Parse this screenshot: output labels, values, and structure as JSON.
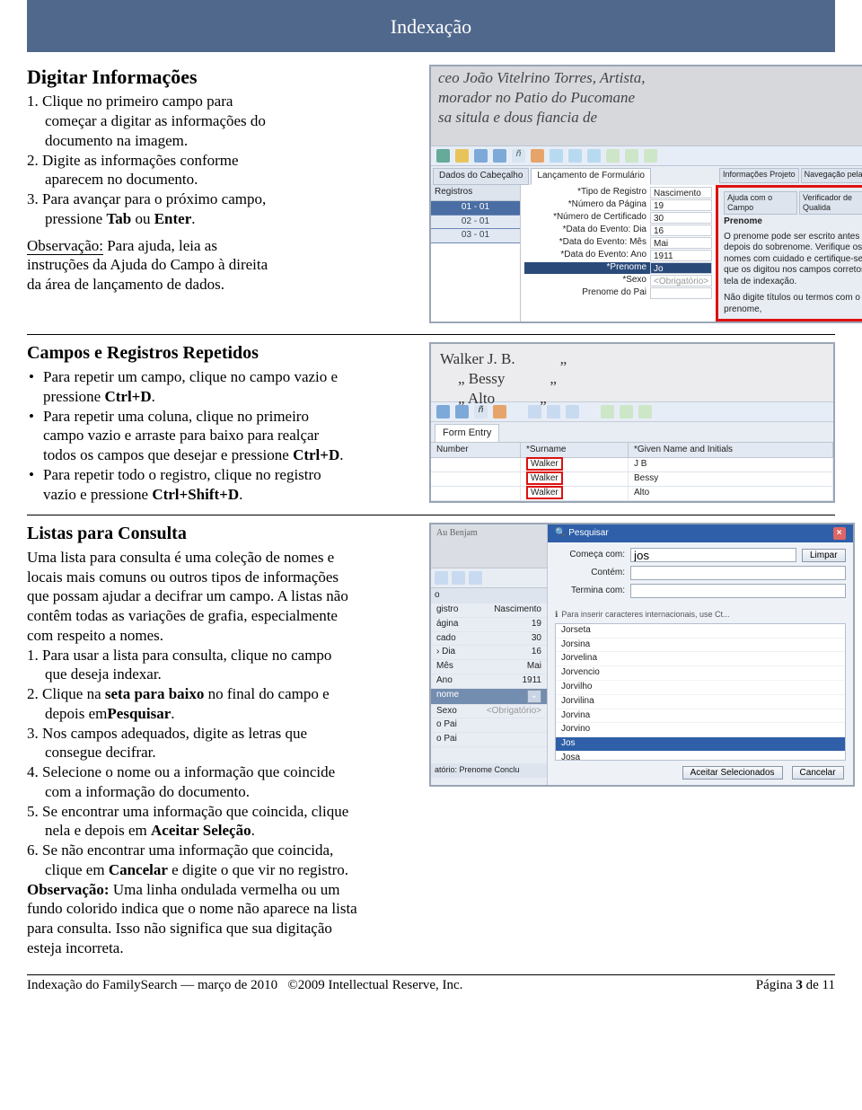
{
  "banner": "Indexação",
  "sec1": {
    "title": "Digitar Informações",
    "steps": [
      "Clique no primeiro campo para\ncomeçar a digitar as informações do\ndocumento na imagem.",
      "Digite as informações conforme\naparecem no documento.",
      "Para avançar para o próximo campo,\npressione Tab ou Enter."
    ],
    "obs_label": "Observação:",
    "obs_text": "Para ajuda, leia as\ninstruções da Ajuda do Campo à direita\nda área de lançamento de dados."
  },
  "shot1": {
    "cursive": "ceo João Vitelrino Torres, Artista,\nmorador no Patio do Pucomane\nsa situla e dous fiancia de",
    "tabs_top": [
      "Dados do Cabeçalho",
      "Lançamento de Formulário"
    ],
    "help_tabs": [
      "Informações Projeto",
      "Navegação pela Imag",
      "Ajuda com o Campo",
      "Verificador de Qualida"
    ],
    "reg_header": "Registros",
    "reg_items": [
      "01 - 01",
      "02 - 01",
      "03 - 01"
    ],
    "fields": [
      {
        "label": "*Tipo de Registro",
        "value": "Nascimento"
      },
      {
        "label": "*Número da Página",
        "value": "19"
      },
      {
        "label": "*Número de Certificado",
        "value": "30"
      },
      {
        "label": "*Data do Evento: Dia",
        "value": "16"
      },
      {
        "label": "*Data do Evento: Mês",
        "value": "Mai"
      },
      {
        "label": "*Data do Evento: Ano",
        "value": "1911"
      },
      {
        "label": "*Prenome",
        "value": "Jo",
        "hl": true
      },
      {
        "label": "*Sexo",
        "value": "<Obrigatório>",
        "gray": true
      },
      {
        "label": "Prenome do Pai",
        "value": ""
      }
    ],
    "help_title": "Prenome",
    "help_lines": [
      "O prenome pode ser escrito antes ou depois do sobrenome. Verifique os nomes com cuidado e certifique-se de que os digitou nos campos corretos na tela de indexação.",
      "Não digite títulos ou termos com o prenome,"
    ]
  },
  "sec2": {
    "title": "Campos e Registros Repetidos",
    "bullets": [
      "Para repetir um campo, clique no campo vazio e\npressione Ctrl+D.",
      "Para repetir uma coluna, clique no primeiro\ncampo vazio e arraste para baixo para realçar\ntodos os campos que desejar e pressione Ctrl+D.",
      "Para repetir todo o registro, clique no registro\nvazio e pressione Ctrl+Shift+D."
    ]
  },
  "shot2": {
    "names": [
      "Walker J. B.",
      "Bessy",
      "Alto"
    ],
    "tab": "Form Entry",
    "headers": [
      "Number",
      "*Surname",
      "*Given Name and Initials"
    ],
    "rows": [
      {
        "surname": "Walker",
        "given": "J B"
      },
      {
        "surname": "Walker",
        "given": "Bessy"
      },
      {
        "surname": "Walker",
        "given": "Alto"
      }
    ]
  },
  "sec3": {
    "title": "Listas para Consulta",
    "intro": "Uma lista para consulta é uma coleção de nomes e\nlocais mais comuns ou outros tipos de informações\nque possam ajudar a decifrar um campo. A listas não\ncontêm todas as variações de grafia, especialmente\ncom respeito a nomes.",
    "steps": [
      "Para usar a lista para consulta, clique no campo\nque deseja indexar.",
      "Clique na seta para baixo no final do campo e\ndepois emPesquisar.",
      "Nos campos adequados, digite as letras que\nconsegue decifrar.",
      "Selecione o nome ou a informação que coincide\ncom a informação do documento.",
      "Se encontrar uma informação que coincida, clique\nnela e depois em Aceitar Seleção.",
      "Se não encontrar uma informação que coincida,\nclique em Cancelar e digite o que vir no registro."
    ],
    "obs_label": "Observação:",
    "obs_text": "Uma linha ondulada vermelha ou um\nfundo colorido indica que o nome não aparece na lista\npara consulta. Isso não significa que sua digitação\nesteja incorreta."
  },
  "shot3": {
    "left_fields": [
      {
        "l": "gistro",
        "v": "Nascimento"
      },
      {
        "l": "ágina",
        "v": "19"
      },
      {
        "l": "cado",
        "v": "30"
      },
      {
        "l": "› Dia",
        "v": "16"
      },
      {
        "l": "Mês",
        "v": "Mai"
      },
      {
        "l": "Ano",
        "v": "1911"
      },
      {
        "l": "nome",
        "v": "",
        "hl": true
      },
      {
        "l": "Sexo",
        "v": "<Obrigatório>",
        "gray": true
      },
      {
        "l": "o Pai",
        "v": ""
      },
      {
        "l": "o Pai",
        "v": ""
      }
    ],
    "left_footer": "atório: Prenome   Conclu",
    "title": "Pesquisar",
    "begins_label": "Começa com:",
    "begins_val": "jos",
    "clear": "Limpar",
    "contains_label": "Contém:",
    "ends_label": "Termina com:",
    "note": "Para inserir caracteres internacionais, use Ct...",
    "list": [
      "Jorseta",
      "Jorsina",
      "Jorvelina",
      "Jorvencio",
      "Jorvilho",
      "Jorvilina",
      "Jorvina",
      "Jorvino",
      "Jos",
      "Josa"
    ],
    "selected": "Jos",
    "accept": "Aceitar Selecionados",
    "cancel": "Cancelar"
  },
  "footer": {
    "left": "Indexação do FamilySearch — março de 2010",
    "mid": "©2009 Intellectual Reserve, Inc.",
    "right_prefix": "Página ",
    "page": "3",
    "of": " de ",
    "total": "11"
  }
}
